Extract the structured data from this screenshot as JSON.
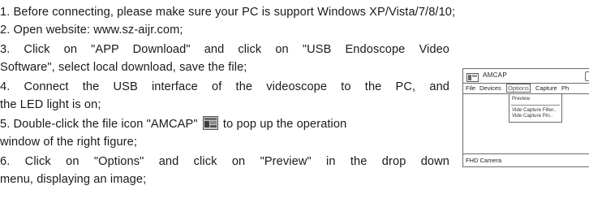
{
  "instructions": {
    "step1": "1. Before connecting, please make sure your PC is  support Windows XP/Vista/7/8/10;",
    "step2": "2. Open website: www.sz-aijr.com;",
    "step3_line1": "3. Click on \"APP Download\" and click on \"USB Endoscope Video",
    "step3_line2": "Software\", select local download, save the file;",
    "step4_line1": "4. Connect the USB interface of the videoscope to the PC, and",
    "step4_line2": "the LED light is on;",
    "step5_line1_before": "5. Double-click the file icon \"AMCAP\"",
    "step5_line1_after": " to pop up the operation",
    "step5_line2": "window of the right figure;",
    "step6_line1": "6. Click on \"Options\" and click on \"Preview\" in the drop down",
    "step6_line2": "menu, displaying an image;"
  },
  "amcap_window": {
    "title": "AMCAP",
    "menu": [
      "File",
      "Devices",
      "Options",
      "Capture",
      "Ph"
    ],
    "dropdown_items": [
      "Preview",
      "Vide Capture Filter..",
      "Vide Capture Pin.."
    ],
    "status_text": "FHD Camera"
  }
}
